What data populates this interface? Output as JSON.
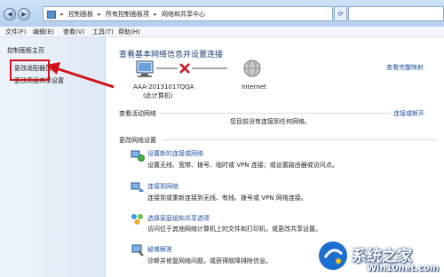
{
  "breadcrumb": [
    "控制面板",
    "所有控制面板项",
    "网络和共享中心"
  ],
  "menu": [
    "文件(F)",
    "编辑(E)",
    "查看(V)",
    "工具(T)",
    "帮助(H)"
  ],
  "sidebar": {
    "items": [
      {
        "label": "控制面板主页"
      },
      {
        "label": "更改适配器设置"
      },
      {
        "label": "更改高级共享设置"
      }
    ]
  },
  "main": {
    "title": "查看基本网络信息并设置连接",
    "full_map_link": "查看完整映射",
    "computer_name": "AAA-20131017QQA",
    "computer_sub": "(此计算机)",
    "internet_label": "Internet",
    "active_header": "查看活动网络",
    "connect_or_disconnect": "连接或断开",
    "not_connected_msg": "您目前没有连接到任何网络。",
    "change_header": "更改网络设置",
    "tasks": [
      {
        "title": "设置新的连接或网络",
        "desc": "设置无线、宽带、拨号、临时或 VPN 连接；或设置路由器或访问点。"
      },
      {
        "title": "连接到网络",
        "desc": "连接到或重新连接到无线、有线、拨号或 VPN 网络连接。"
      },
      {
        "title": "选择家庭组和共享选项",
        "desc": "访问位于其他网络计算机上的文件和打印机，或更改共享设置。"
      },
      {
        "title": "疑难解答",
        "desc": "诊断并修复网络问题，或获得故障排除信息。"
      }
    ]
  },
  "watermark": {
    "line1": "系统之家",
    "line2": "Win10net.com"
  },
  "colors": {
    "accent_link": "#1f4e9a",
    "highlight_box": "#d3111b",
    "disconnect_x": "#d3111b"
  }
}
